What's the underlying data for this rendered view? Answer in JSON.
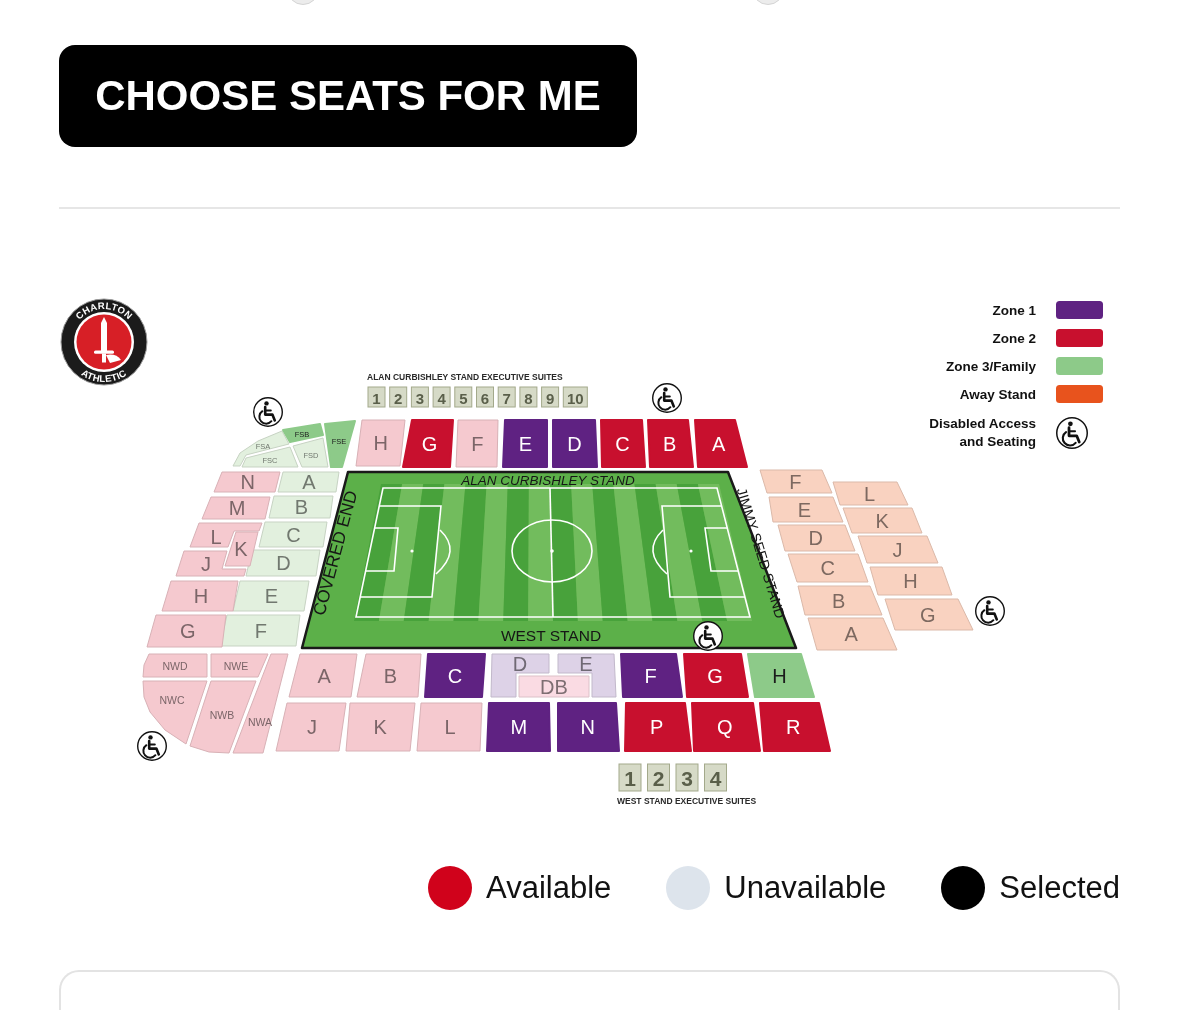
{
  "choose_button": {
    "label": "CHOOSE SEATS FOR ME"
  },
  "stadium_map": {
    "logo": {
      "top_text": "CHARLTON",
      "bottom_text": "ATHLETIC"
    },
    "zone_legend": [
      {
        "kind": "swatch",
        "label": "Zone 1",
        "color": "#5f2282"
      },
      {
        "kind": "swatch",
        "label": "Zone 2",
        "color": "#c8102e"
      },
      {
        "kind": "swatch",
        "label": "Zone 3/Family",
        "color": "#8dca89"
      },
      {
        "kind": "swatch",
        "label": "Away Stand",
        "color": "#e8531d"
      },
      {
        "kind": "wheelchair",
        "lines": [
          "Disabled Access",
          "and Seating"
        ]
      }
    ],
    "top_suites": {
      "title": "ALAN CURBISHLEY STAND EXECUTIVE SUITES",
      "suites": [
        "1",
        "2",
        "3",
        "4",
        "5",
        "6",
        "7",
        "8",
        "9",
        "10"
      ]
    },
    "stand_names": [
      "ALAN CURBISHLEY STAND",
      "COVERED END",
      "JIMMY SEED STAND",
      "WEST STAND"
    ],
    "sections": {
      "top_left_corner": [
        {
          "label": "FSA",
          "color": "#e2f0de",
          "available": false
        },
        {
          "label": "FSB",
          "color": "#8dca89",
          "available": true
        },
        {
          "label": "FSC",
          "color": "#e2f0de",
          "available": false
        },
        {
          "label": "FSD",
          "color": "#e2f0de",
          "available": false
        },
        {
          "label": "FSE",
          "color": "#8dca89",
          "available": true
        }
      ],
      "top_stand": [
        {
          "label": "H",
          "color": "#f5c9cf",
          "available": false
        },
        {
          "label": "G",
          "color": "#c8102e",
          "available": true
        },
        {
          "label": "F",
          "color": "#f5c9cf",
          "available": false
        },
        {
          "label": "E",
          "color": "#5f2282",
          "available": true
        },
        {
          "label": "D",
          "color": "#5f2282",
          "available": true
        },
        {
          "label": "C",
          "color": "#c8102e",
          "available": true
        },
        {
          "label": "B",
          "color": "#c8102e",
          "available": true
        },
        {
          "label": "A",
          "color": "#c8102e",
          "available": true
        }
      ],
      "left_inner": [
        {
          "label": "A",
          "color": "#e2f0de",
          "available": false
        },
        {
          "label": "B",
          "color": "#e2f0de",
          "available": false
        },
        {
          "label": "C",
          "color": "#e2f0de",
          "available": false
        },
        {
          "label": "D",
          "color": "#e2f0de",
          "available": false
        },
        {
          "label": "E",
          "color": "#e2f0de",
          "available": false
        },
        {
          "label": "F",
          "color": "#e2f0de",
          "available": false
        }
      ],
      "left_outer": [
        {
          "label": "N",
          "color": "#f5c9cf",
          "available": false
        },
        {
          "label": "M",
          "color": "#f5c9cf",
          "available": false
        },
        {
          "label": "L",
          "color": "#f5c9cf",
          "available": false
        },
        {
          "label": "K",
          "color": "#f5c9cf",
          "available": false
        },
        {
          "label": "J",
          "color": "#f5c9cf",
          "available": false
        },
        {
          "label": "H",
          "color": "#f5c9cf",
          "available": false
        },
        {
          "label": "G",
          "color": "#f5c9cf",
          "available": false
        }
      ],
      "right_inner": [
        {
          "label": "F",
          "color": "#f9d2c0",
          "available": false
        },
        {
          "label": "E",
          "color": "#f9d2c0",
          "available": false
        },
        {
          "label": "D",
          "color": "#f9d2c0",
          "available": false
        },
        {
          "label": "C",
          "color": "#f9d2c0",
          "available": false
        },
        {
          "label": "B",
          "color": "#f9d2c0",
          "available": false
        },
        {
          "label": "A",
          "color": "#f9d2c0",
          "available": false
        }
      ],
      "right_outer": [
        {
          "label": "L",
          "color": "#f9d2c0",
          "available": false
        },
        {
          "label": "K",
          "color": "#f9d2c0",
          "available": false
        },
        {
          "label": "J",
          "color": "#f9d2c0",
          "available": false
        },
        {
          "label": "H",
          "color": "#f9d2c0",
          "available": false
        },
        {
          "label": "G",
          "color": "#f9d2c0",
          "available": false
        }
      ],
      "bottom_left_corner": [
        {
          "label": "NWD",
          "color": "#f5c9cf",
          "available": false
        },
        {
          "label": "NWE",
          "color": "#f5c9cf",
          "available": false
        },
        {
          "label": "NWC",
          "color": "#f5c9cf",
          "available": false
        },
        {
          "label": "NWB",
          "color": "#f5c9cf",
          "available": false
        },
        {
          "label": "NWA",
          "color": "#f5c9cf",
          "available": false
        }
      ],
      "bottom_row_1": [
        {
          "label": "A",
          "color": "#f5c9cf",
          "available": false
        },
        {
          "label": "B",
          "color": "#f5c9cf",
          "available": false
        },
        {
          "label": "C",
          "color": "#5f2282",
          "available": true
        },
        {
          "label": "D",
          "color": "#ddd2e7",
          "available": false
        },
        {
          "label": "E",
          "color": "#ddd2e7",
          "available": false
        },
        {
          "label": "DB",
          "color": "#fadbe3",
          "available": false
        },
        {
          "label": "F",
          "color": "#5f2282",
          "available": true
        },
        {
          "label": "G",
          "color": "#c8102e",
          "available": true
        },
        {
          "label": "H",
          "color": "#8dca89",
          "available": true
        }
      ],
      "bottom_row_2": [
        {
          "label": "J",
          "color": "#f5c9cf",
          "available": false
        },
        {
          "label": "K",
          "color": "#f5c9cf",
          "available": false
        },
        {
          "label": "L",
          "color": "#f5c9cf",
          "available": false
        },
        {
          "label": "M",
          "color": "#5f2282",
          "available": true
        },
        {
          "label": "N",
          "color": "#5f2282",
          "available": true
        },
        {
          "label": "P",
          "color": "#c8102e",
          "available": true
        },
        {
          "label": "Q",
          "color": "#c8102e",
          "available": true
        },
        {
          "label": "R",
          "color": "#c8102e",
          "available": true
        }
      ]
    },
    "bottom_suites": {
      "title": "WEST STAND EXECUTIVE SUITES",
      "suites": [
        "1",
        "2",
        "3",
        "4"
      ]
    }
  },
  "availability_legend": [
    {
      "label": "Available",
      "color": "#d0021b"
    },
    {
      "label": "Unavailable",
      "color": "#dde4ec"
    },
    {
      "label": "Selected",
      "color": "#000000"
    }
  ]
}
